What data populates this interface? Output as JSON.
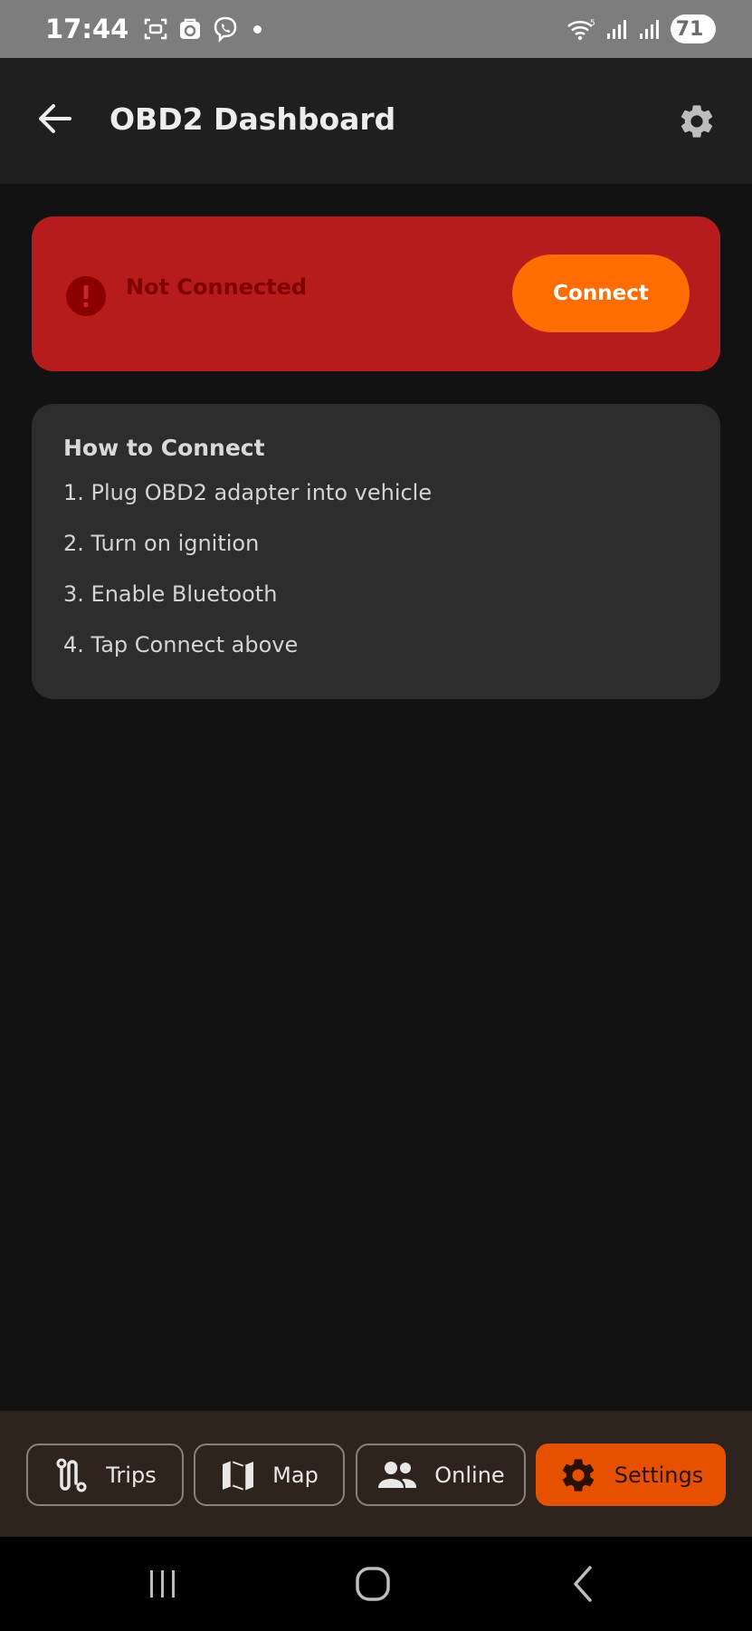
{
  "status_bar": {
    "time": "17:44",
    "battery_level": "71",
    "icons": [
      "screenshot-icon",
      "store-icon",
      "viber-icon",
      "dot-icon",
      "wifi-icon",
      "signal-icon",
      "signal-icon-2"
    ]
  },
  "app_bar": {
    "title": "OBD2 Dashboard",
    "back_icon": "arrow-left-icon",
    "settings_icon": "gear-icon"
  },
  "connection": {
    "status_text": "Not Connected",
    "button_label": "Connect",
    "status_icon": "alert-circle-icon"
  },
  "howto": {
    "title": "How to Connect",
    "steps": [
      "1. Plug OBD2 adapter into vehicle",
      "2. Turn on ignition",
      "3. Enable Bluetooth",
      "4. Tap Connect above"
    ]
  },
  "bottom_nav": {
    "items": [
      {
        "label": "Trips",
        "icon": "route-icon",
        "active": false
      },
      {
        "label": "Map",
        "icon": "map-icon",
        "active": false
      },
      {
        "label": "Online",
        "icon": "people-icon",
        "active": false
      },
      {
        "label": "Settings",
        "icon": "gear-icon",
        "active": true
      }
    ]
  },
  "colors": {
    "background": "#121212",
    "app_bar": "#1f1f1f",
    "error_card": "#b71c1c",
    "accent": "#ff6d00",
    "active_nav": "#e65100",
    "card": "#2d2d2d"
  }
}
